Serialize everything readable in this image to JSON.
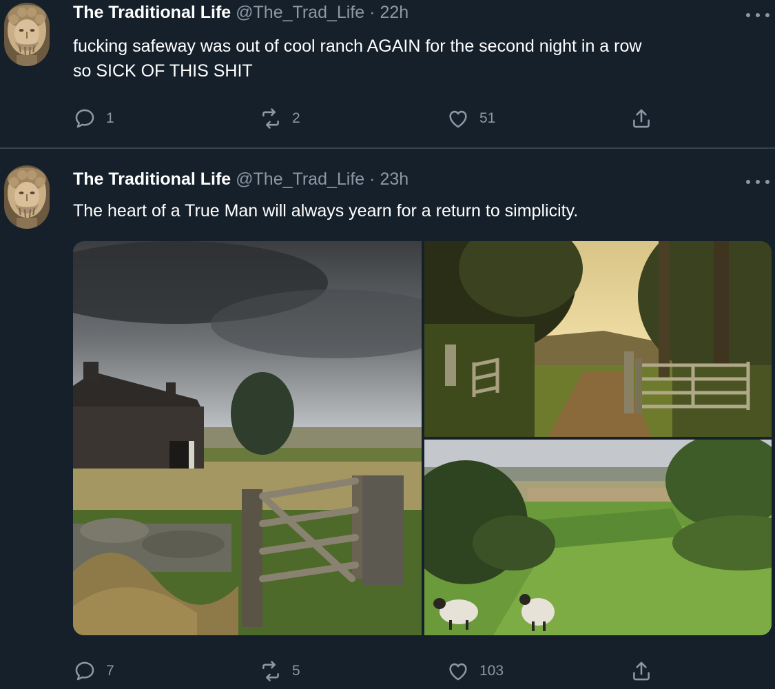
{
  "tweets": [
    {
      "name": "The Traditional Life",
      "handle": "@The_Trad_Life",
      "separator": "·",
      "time": "22h",
      "text_line1": "fucking safeway was out of cool ranch AGAIN for the second night in a row",
      "text_line2": "so SICK OF THIS SHIT",
      "replies": "1",
      "retweets": "2",
      "likes": "51"
    },
    {
      "name": "The Traditional Life",
      "handle": "@The_Trad_Life",
      "separator": "·",
      "time": "23h",
      "text_line1": "The heart of a True Man will always yearn for a return to simplicity.",
      "replies": "7",
      "retweets": "5",
      "likes": "103",
      "media": [
        "stone-farmhouse-with-gate-photo",
        "country-lane-gate-photo",
        "green-pasture-sheep-photo"
      ]
    }
  ],
  "icons": [
    "avatar-statue-icon",
    "more-options-icon",
    "reply-icon",
    "retweet-icon",
    "like-icon",
    "share-icon"
  ],
  "colors": {
    "background": "#15202b",
    "secondary_text": "#8b98a5",
    "divider": "#38444d",
    "text": "#ffffff"
  }
}
